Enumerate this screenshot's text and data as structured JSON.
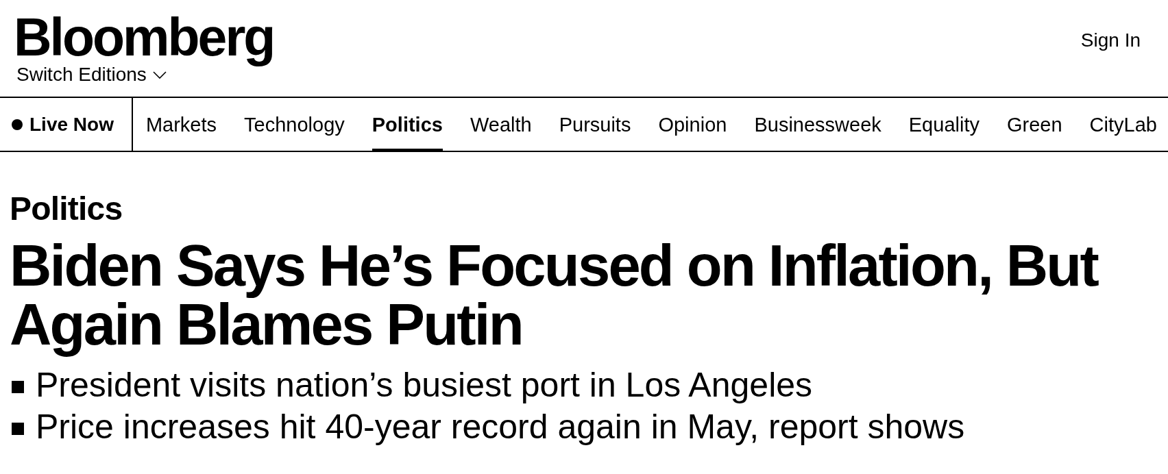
{
  "header": {
    "logo": "Bloomberg",
    "edition_switcher": "Switch Editions",
    "sign_in": "Sign In"
  },
  "nav": {
    "live": {
      "label": "Live Now"
    },
    "items": [
      {
        "label": "Markets",
        "selected": false
      },
      {
        "label": "Technology",
        "selected": false
      },
      {
        "label": "Politics",
        "selected": true
      },
      {
        "label": "Wealth",
        "selected": false
      },
      {
        "label": "Pursuits",
        "selected": false
      },
      {
        "label": "Opinion",
        "selected": false
      },
      {
        "label": "Businessweek",
        "selected": false
      },
      {
        "label": "Equality",
        "selected": false
      },
      {
        "label": "Green",
        "selected": false
      },
      {
        "label": "CityLab",
        "selected": false
      }
    ]
  },
  "article": {
    "section": "Politics",
    "headline": "Biden Says He’s Focused on Inflation, But Again Blames Putin",
    "bullets": [
      "President visits nation’s busiest port in Los Angeles",
      "Price increases hit 40-year record again in May, report shows"
    ]
  }
}
